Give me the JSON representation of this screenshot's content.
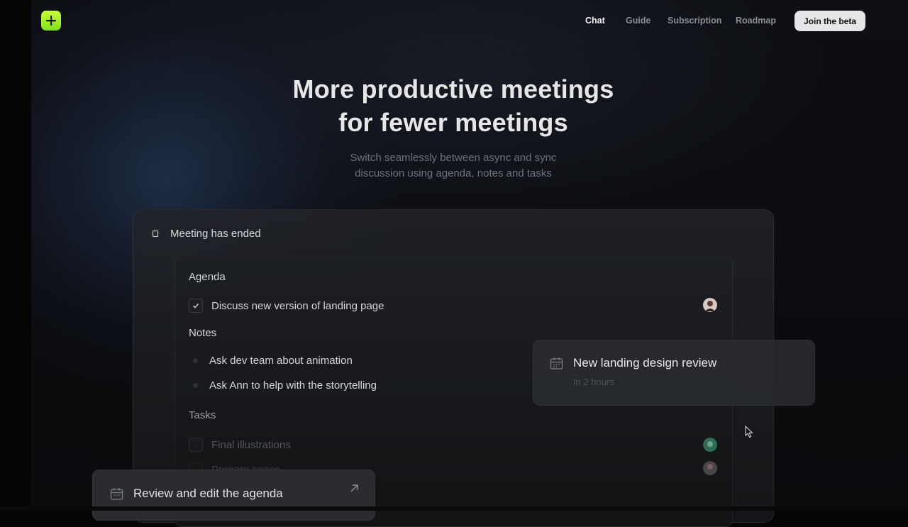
{
  "nav": {
    "items": [
      "Chat",
      "Guide",
      "Subscription",
      "Roadmap"
    ],
    "active": "Chat",
    "cta": "Join the beta"
  },
  "hero": {
    "title_line1": "More productive meetings",
    "title_line2": "for fewer meetings",
    "subtitle_line1": "Switch seamlessly between async and sync",
    "subtitle_line2": "discussion using agenda, notes and tasks"
  },
  "meeting": {
    "status": "Meeting has ended",
    "agenda_title": "Agenda",
    "agenda_items": [
      {
        "label": "Discuss new version of landing page",
        "checked": true
      }
    ],
    "notes_title": "Notes",
    "notes": [
      "Ask dev team about animation",
      "Ask Ann to help with the storytelling"
    ],
    "tasks_title": "Tasks",
    "tasks": [
      "Final illustrations",
      "Prepare space"
    ]
  },
  "float_card": {
    "title": "New landing design review",
    "subtitle": "In 2 hours"
  },
  "bottom_card": {
    "title": "Review and edit the agenda"
  },
  "colors": {
    "accent": "#a8f22a",
    "background": "#0a0b0d"
  }
}
